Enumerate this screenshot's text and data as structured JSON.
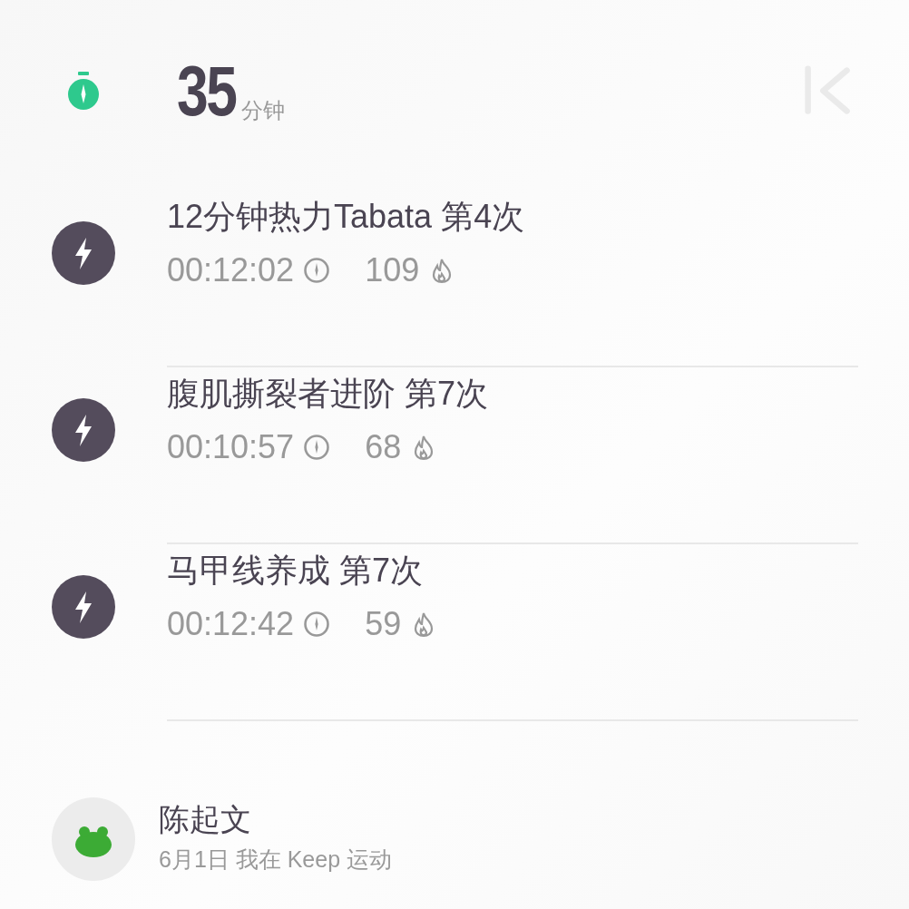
{
  "summary": {
    "value": "35",
    "unit": "分钟"
  },
  "workouts": [
    {
      "title": "12分钟热力Tabata 第4次",
      "duration": "00:12:02",
      "calories": "109"
    },
    {
      "title": "腹肌撕裂者进阶 第7次",
      "duration": "00:10:57",
      "calories": "68"
    },
    {
      "title": "马甲线养成 第7次",
      "duration": "00:12:42",
      "calories": "59"
    }
  ],
  "user": {
    "name": "陈起文",
    "caption": "6月1日 我在 Keep 运动"
  }
}
